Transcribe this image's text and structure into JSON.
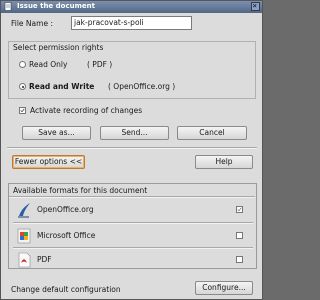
{
  "window": {
    "title": "Issue the document"
  },
  "file_name": {
    "label": "File Name :",
    "value": "jak-pracovat-s-poli"
  },
  "permissions": {
    "title": "Select permission rights",
    "read_only": {
      "label": "Read Only",
      "format": "( PDF )",
      "selected": false
    },
    "read_write": {
      "label": "Read and Write",
      "format": "( OpenOffice.org )",
      "selected": true
    }
  },
  "recording": {
    "label": "Activate recording of changes",
    "checked": true
  },
  "buttons": {
    "save_as": "Save as...",
    "send": "Send...",
    "cancel": "Cancel",
    "fewer_options": "Fewer options <<",
    "help": "Help",
    "configure": "Configure..."
  },
  "formats": {
    "title": "Available formats for this document",
    "items": [
      {
        "name": "OpenOffice.org",
        "icon": "openoffice-icon",
        "checked": true
      },
      {
        "name": "Microsoft Office",
        "icon": "microsoft-office-icon",
        "checked": false
      },
      {
        "name": "PDF",
        "icon": "pdf-icon",
        "checked": false
      }
    ]
  },
  "footer": {
    "label": "Change default configuration"
  }
}
